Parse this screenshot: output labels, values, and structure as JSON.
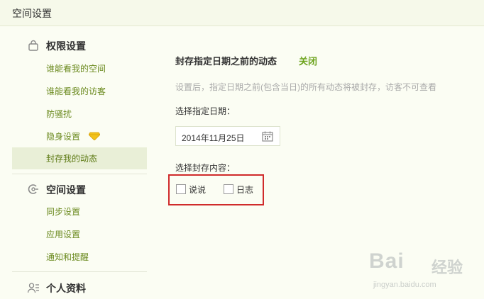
{
  "window": {
    "title": "空间设置"
  },
  "sidebar": {
    "sections": [
      {
        "label": "权限设置",
        "icon": "lock-icon"
      },
      {
        "label": "空间设置",
        "icon": "space-settings-icon"
      },
      {
        "label": "个人资料",
        "icon": "profile-icon"
      }
    ],
    "items": [
      {
        "label": "谁能看我的空间"
      },
      {
        "label": "谁能看我的访客"
      },
      {
        "label": "防骚扰"
      },
      {
        "label": "隐身设置",
        "icon": "vip-diamond-icon"
      },
      {
        "label": "封存我的动态",
        "active": true
      },
      {
        "label": "同步设置"
      },
      {
        "label": "应用设置"
      },
      {
        "label": "通知和提醒"
      }
    ]
  },
  "main": {
    "heading": "封存指定日期之前的动态",
    "toggle_label": "关闭",
    "description": "设置后，指定日期之前(包含当日)的所有动态将被封存，访客不可查看",
    "date_label": "选择指定日期：",
    "date_value": "2014年11月25日",
    "date_icon": "calendar-icon",
    "content_label": "选择封存内容：",
    "options": [
      {
        "label": "说说",
        "checked": false
      },
      {
        "label": "日志",
        "checked": false
      }
    ]
  },
  "watermark": {
    "brand": "Bai",
    "brand_suffix": "经验",
    "url": "jingyan.baidu.com"
  },
  "colors": {
    "accent_green": "#6ca31c",
    "link_green": "#6b8a1f",
    "highlight_red": "#d02b2b",
    "active_bg": "#e9efd7"
  }
}
